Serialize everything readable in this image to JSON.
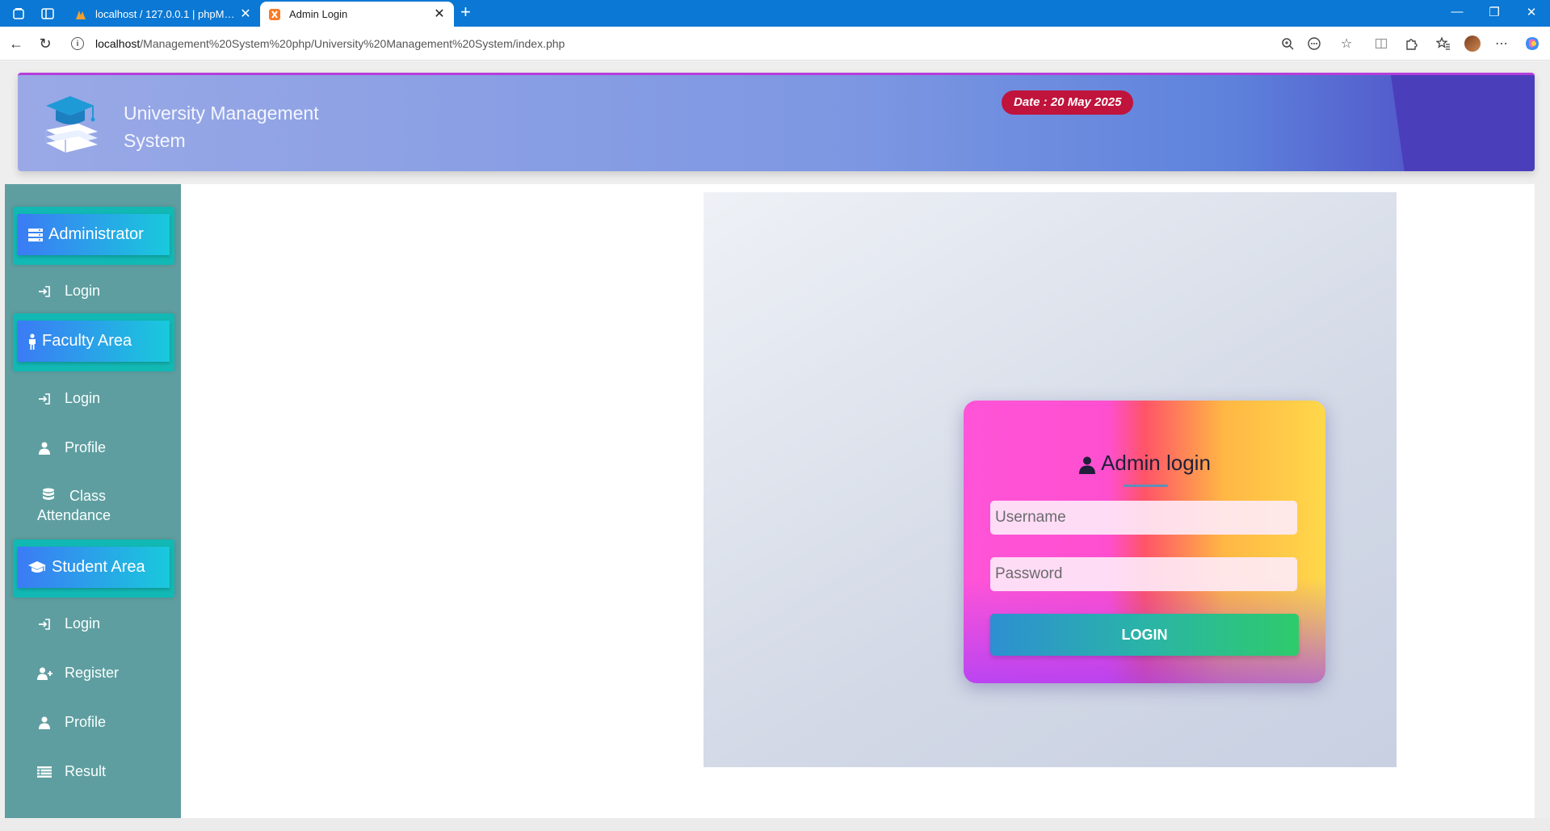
{
  "browser": {
    "tabs": [
      {
        "title": "localhost / 127.0.0.1 | phpMyAdmin",
        "active": false
      },
      {
        "title": "Admin Login",
        "active": true
      }
    ],
    "url_host": "localhost",
    "url_path": "/Management%20System%20php/University%20Management%20System/index.php"
  },
  "header": {
    "title": "University Management System",
    "date": "Date : 20 May 2025"
  },
  "sidebar": {
    "administrator": {
      "label": "Administrator",
      "links": [
        {
          "label": "Login",
          "icon": "sign-in-icon"
        }
      ]
    },
    "faculty": {
      "label": "Faculty Area",
      "links": [
        {
          "label": "Login",
          "icon": "sign-in-icon"
        },
        {
          "label": "Profile",
          "icon": "user-icon"
        },
        {
          "label": "Class Attendance",
          "icon": "database-icon"
        }
      ]
    },
    "student": {
      "label": "Student Area",
      "links": [
        {
          "label": "Login",
          "icon": "sign-in-icon"
        },
        {
          "label": "Register",
          "icon": "user-plus-icon"
        },
        {
          "label": "Profile",
          "icon": "user-icon"
        },
        {
          "label": "Result",
          "icon": "list-icon"
        }
      ]
    }
  },
  "login_form": {
    "title": "Admin login",
    "username_placeholder": "Username",
    "password_placeholder": "Password",
    "submit_label": "LOGIN"
  },
  "colors": {
    "browser_accent": "#0a78d4",
    "sidebar_bg": "#5f9ea0",
    "date_badge": "#c0143c",
    "login_button": "#2ab4a7"
  }
}
